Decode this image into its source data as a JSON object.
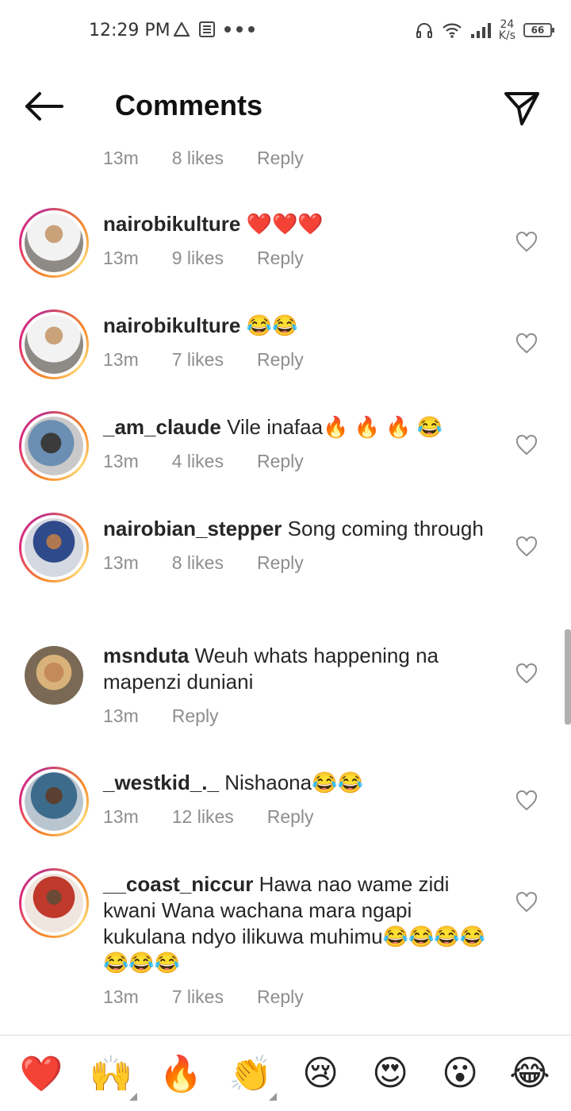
{
  "status_bar": {
    "time": "12:29 PM",
    "net_speed_value": "24",
    "net_speed_unit": "K/s",
    "battery": "66"
  },
  "header": {
    "title": "Comments"
  },
  "partial_comment": {
    "time": "13m",
    "likes": "8 likes",
    "reply": "Reply"
  },
  "comments": [
    {
      "username": "nairobikulture",
      "text": "❤️❤️❤️",
      "time": "13m",
      "likes": "9 likes",
      "reply": "Reply"
    },
    {
      "username": "nairobikulture",
      "text": "😂😂",
      "time": "13m",
      "likes": "7 likes",
      "reply": "Reply"
    },
    {
      "username": "_am_claude",
      "text": "Vile inafaa🔥 🔥 🔥 😂",
      "time": "13m",
      "likes": "4 likes",
      "reply": "Reply"
    },
    {
      "username": "nairobian_stepper",
      "text": "Song coming through",
      "time": "13m",
      "likes": "8 likes",
      "reply": "Reply"
    },
    {
      "username": "msnduta",
      "text": "Weuh whats happening na mapenzi duniani",
      "time": "13m",
      "likes": "",
      "reply": "Reply"
    },
    {
      "username": "_westkid_._",
      "text": "Nishaona😂😂",
      "time": "13m",
      "likes": "12 likes",
      "reply": "Reply"
    },
    {
      "username": "__coast_niccur",
      "text": "Hawa nao wame zidi kwani Wana wachana mara ngapi kukulana ndyo ilikuwa muhimu😂😂😂😂😂😂😂",
      "time": "13m",
      "likes": "7 likes",
      "reply": "Reply"
    }
  ],
  "emoji_bar": [
    "❤️",
    "🙌",
    "🔥",
    "👏",
    "😢",
    "😍",
    "😮",
    "😂"
  ],
  "colors": {
    "accent_ring_start": "#f58529",
    "accent_ring_mid": "#dd2a7b",
    "meta_gray": "#8e8e8e"
  }
}
